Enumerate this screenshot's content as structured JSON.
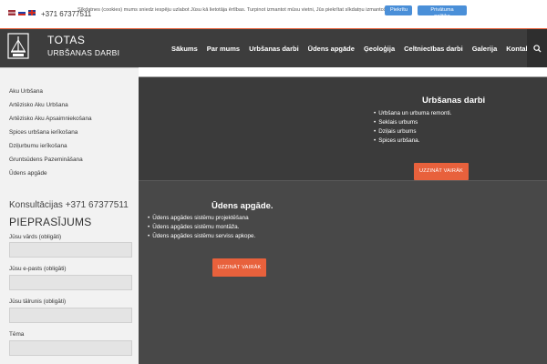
{
  "topbar": {
    "flags": [
      "flag-lv",
      "flag-ru",
      "flag-en"
    ],
    "phone": "+371 67377511",
    "cookie_text": "Sīkdatnes (cookies) mums sniedz iespēju uzlabot Jūsu kā lietotāja ērtības. Turpinot izmantot mūsu vietni, Jūs piekrītat sīkdatņu izmantošanai.",
    "cookie_accept": "Piekrītu",
    "cookie_policy": "Privātuma politika"
  },
  "header": {
    "brand_name": "TOTAS",
    "brand_sub": "URBŠANAS DARBI",
    "nav": [
      "Sākums",
      "Par mums",
      "Urbšanas darbi",
      "Ūdens apgāde",
      "Ģeoloģija",
      "Celtniecības darbi",
      "Galerija",
      "Kontakti"
    ],
    "search_icon": "search-icon"
  },
  "sidebar": {
    "links": [
      "Aku Urbšana",
      "Artēzisko Aku Urbšana",
      "Artēzisko Aku Apsaimniekošana",
      "Spices urbšana ierīkošana",
      "Dziļurbumu ierīkošana",
      "Gruntsūdens Pazemināšana",
      "Ūdens apgāde"
    ],
    "consult": "Konsultācijas +371 67377511",
    "form_title": "PIEPRASĪJUMS",
    "fields": [
      "Jūsu vārds (obligāti)",
      "Jūsu e-pasts (obligāti)",
      "Jūsu tālrunis (obligāti)",
      "Tēma"
    ]
  },
  "panels": [
    {
      "title": "Urbšanas darbi",
      "items": [
        "Urbšana un urbuma remonti.",
        "Seklais urbums",
        "Dziļais urbums",
        "Spices urbšana."
      ],
      "button": "UZZINĀT VAIRĀK"
    },
    {
      "title": "Ūdens apgāde.",
      "items": [
        "Ūdens apgādes sistēmu projektēšana",
        "Ūdens apgādes sistēmu montāža.",
        "Ūdens apgādes sistēmu serviss apkope."
      ],
      "button": "UZZINĀT VAIRĀK"
    }
  ],
  "colors": {
    "accent": "#e8613c",
    "header_bg": "#3d3d3d",
    "cookie_button": "#4a8fd8"
  }
}
